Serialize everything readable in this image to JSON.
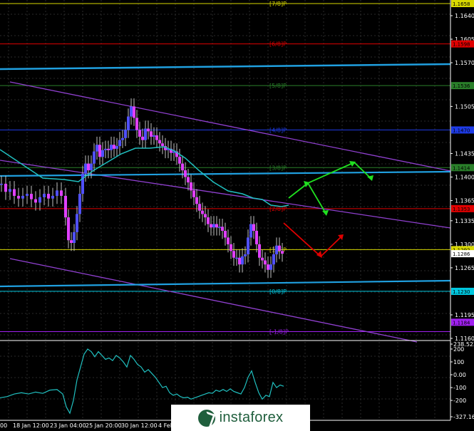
{
  "chart_data": {
    "type": "candlestick",
    "price_axis": {
      "ticks": [
        "1.1658",
        "1.1640",
        "1.1605",
        "1.1598",
        "1.1570",
        "1.1536",
        "1.1505",
        "1.1470",
        "1.1435",
        "1.1414",
        "1.1400",
        "1.1365",
        "1.1353",
        "1.1335",
        "1.1300",
        "1.1292",
        "1.1286",
        "1.1265",
        "1.1230",
        "1.1195",
        "1.1184",
        "1.1160"
      ],
      "ylim": [
        1.116,
        1.1658
      ]
    },
    "oscillator_axis": {
      "ticks": [
        "238.5227",
        "200",
        "100",
        "0.00",
        "-100",
        "-200",
        "-327.167"
      ],
      "ylim": [
        -327.167,
        238.5227
      ]
    },
    "time_axis": [
      "00",
      "18 Jan 12:00",
      "23 Jan 04:00",
      "25 Jan 20:00",
      "30 Jan 12:00",
      "4 Feb"
    ],
    "murrey_levels": [
      {
        "label": "[7/8]P",
        "value": 1.1658,
        "color": "#d8d800"
      },
      {
        "label": "[6/8]P",
        "value": 1.1598,
        "color": "#e00000"
      },
      {
        "label": "[5/8]P",
        "value": 1.1536,
        "color": "#2a7f2a"
      },
      {
        "label": "[4/8]P",
        "value": 1.147,
        "color": "#1e3ce8"
      },
      {
        "label": "[3/8]P",
        "value": 1.1414,
        "color": "#2a7f2a"
      },
      {
        "label": "[2/8]P",
        "value": 1.1353,
        "color": "#e00000"
      },
      {
        "label": "[1/8]P",
        "value": 1.1292,
        "color": "#d8d800"
      },
      {
        "label": "[0/8]P",
        "value": 1.123,
        "color": "#00c8e0"
      },
      {
        "label": "[-1/8]P",
        "value": 1.117,
        "color": "#a020f0"
      }
    ],
    "price_tags": [
      {
        "text": "1.1658",
        "value": 1.1658,
        "bg": "#d8d800"
      },
      {
        "text": "1.1598",
        "value": 1.1598,
        "bg": "#e00000"
      },
      {
        "text": "1.1536",
        "value": 1.1536,
        "bg": "#2a7f2a"
      },
      {
        "text": "1.1470",
        "value": 1.147,
        "bg": "#1e3ce8"
      },
      {
        "text": "1.1414",
        "value": 1.1414,
        "bg": "#2a7f2a"
      },
      {
        "text": "1.1353",
        "value": 1.1353,
        "bg": "#e00000"
      },
      {
        "text": "1.1292",
        "value": 1.1292,
        "bg": "#d8d800"
      },
      {
        "text": "1.1286",
        "value": 1.1286,
        "bg": "#ffffff"
      },
      {
        "text": "1.1230",
        "value": 1.123,
        "bg": "#00c8e0"
      },
      {
        "text": "1.1184",
        "value": 1.1184,
        "bg": "#a020f0"
      }
    ],
    "colors": {
      "up": "#5050ff",
      "down": "#e040ff",
      "ma": "#20c0c0",
      "channel": "#9040d0",
      "forecast_up": "#20e020",
      "forecast_down": "#e00000",
      "cyan_line": "#20a0e0"
    }
  },
  "watermark": {
    "text": "instaforex"
  }
}
